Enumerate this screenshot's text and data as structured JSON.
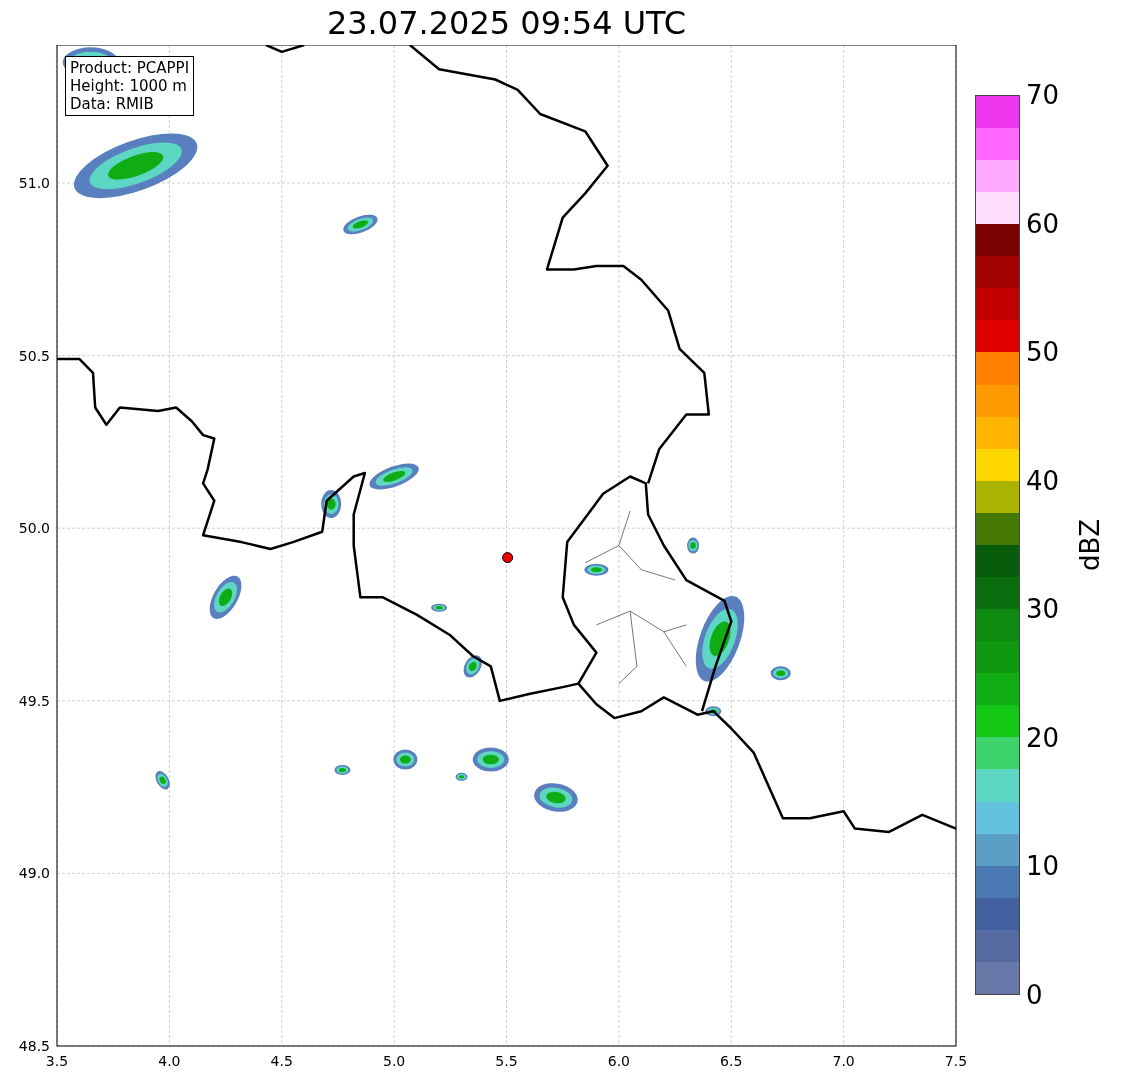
{
  "title": "23.07.2025 09:54 UTC",
  "info_box": [
    "Product: PCAPPI",
    "Height: 1000 m",
    "Data: RMIB"
  ],
  "map": {
    "x_ticks": [
      "3.5",
      "4.0",
      "4.5",
      "5.0",
      "5.5",
      "6.0",
      "6.5",
      "7.0",
      "7.5"
    ],
    "y_ticks": [
      "51.0",
      "50.5",
      "50.0",
      "49.5",
      "49.0",
      "48.5"
    ]
  },
  "colorbar": {
    "label": "dBZ",
    "ticks": [
      "70",
      "60",
      "50",
      "40",
      "30",
      "20",
      "10",
      "0"
    ],
    "segments": [
      {
        "color": "#6677a8"
      },
      {
        "color": "#546aa0"
      },
      {
        "color": "#4260a0"
      },
      {
        "color": "#4a78b2"
      },
      {
        "color": "#5b9ec6"
      },
      {
        "color": "#64c1dd"
      },
      {
        "color": "#5dd6c4"
      },
      {
        "color": "#3dd46b"
      },
      {
        "color": "#13c815"
      },
      {
        "color": "#10ac14"
      },
      {
        "color": "#0f9812"
      },
      {
        "color": "#0e8a10"
      },
      {
        "color": "#0b6e0e"
      },
      {
        "color": "#095c0a"
      },
      {
        "color": "#467805"
      },
      {
        "color": "#a9b300"
      },
      {
        "color": "#ffd700"
      },
      {
        "color": "#ffb400"
      },
      {
        "color": "#ff9a00"
      },
      {
        "color": "#ff7f00"
      },
      {
        "color": "#e00000"
      },
      {
        "color": "#c30000"
      },
      {
        "color": "#a30000"
      },
      {
        "color": "#7b0000"
      },
      {
        "color": "#ffddff"
      },
      {
        "color": "#ffaaff"
      },
      {
        "color": "#ff66ff"
      },
      {
        "color": "#ef36ef"
      }
    ]
  }
}
